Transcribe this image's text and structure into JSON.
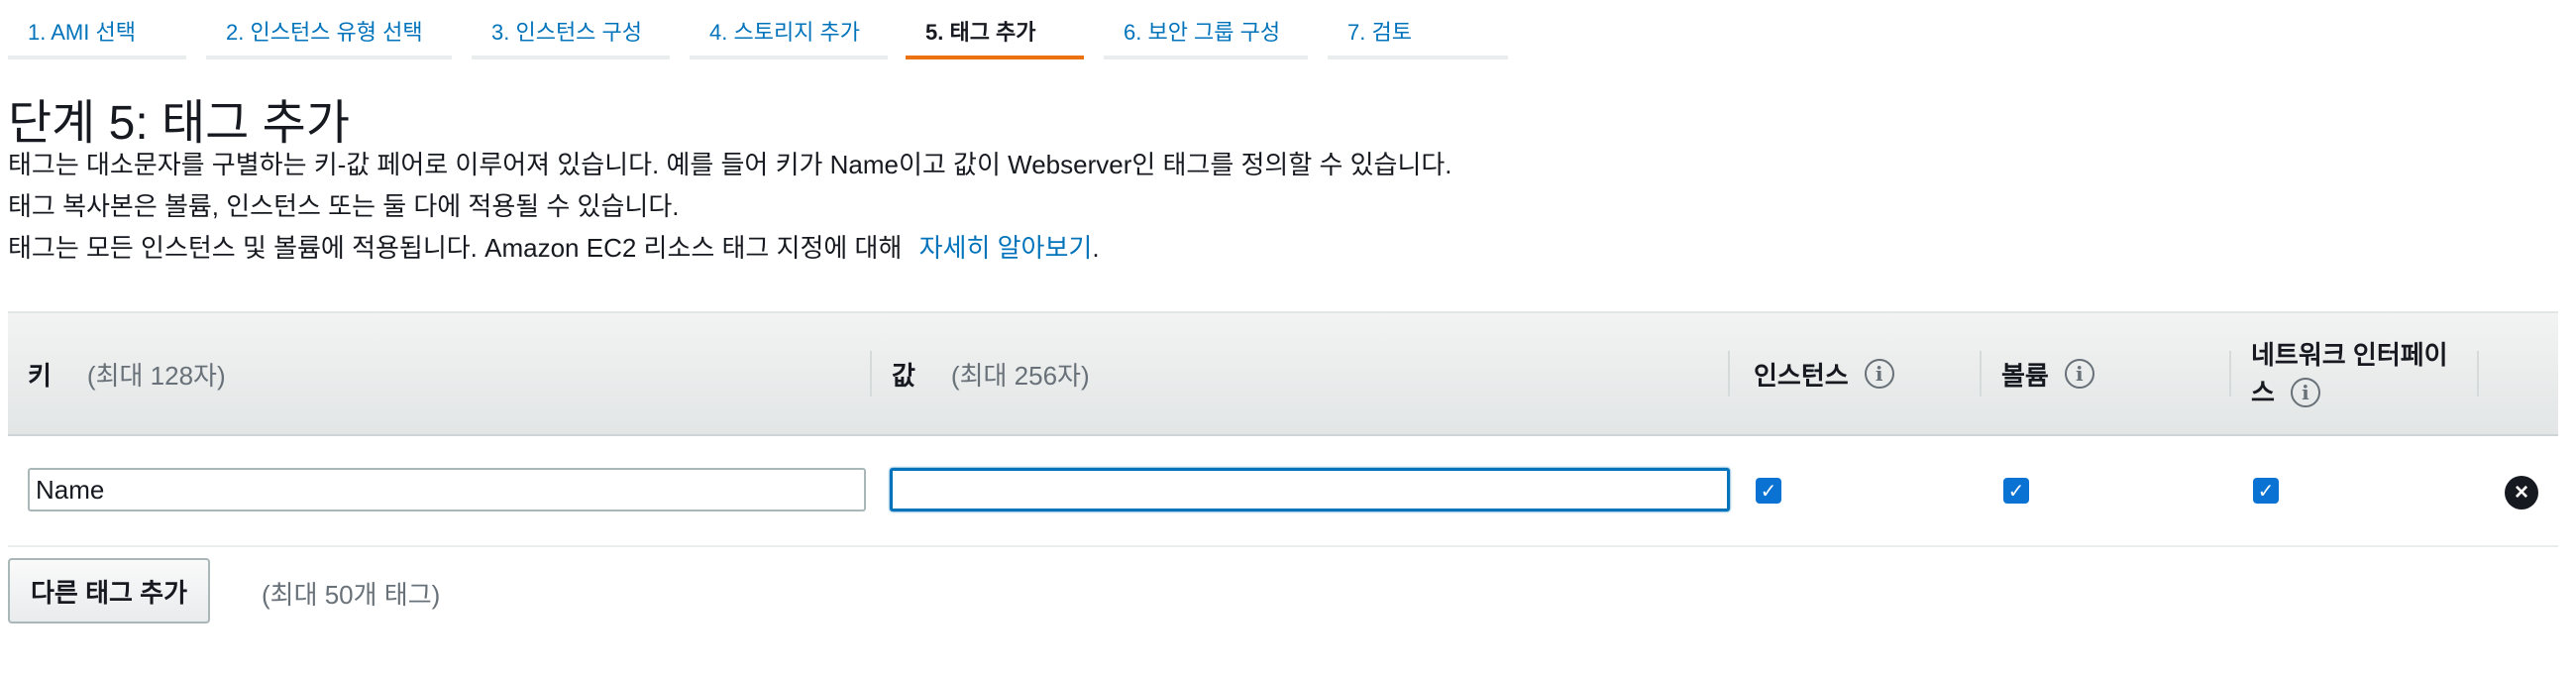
{
  "wizard": {
    "steps": [
      {
        "label": "1. AMI 선택"
      },
      {
        "label": "2. 인스턴스 유형 선택"
      },
      {
        "label": "3. 인스턴스 구성"
      },
      {
        "label": "4. 스토리지 추가"
      },
      {
        "label": "5. 태그 추가"
      },
      {
        "label": "6. 보안 그룹 구성"
      },
      {
        "label": "7. 검토"
      }
    ],
    "active_step": 5
  },
  "page": {
    "title": "단계 5: 태그 추가",
    "desc1": "태그는 대소문자를 구별하는 키-값 페어로 이루어져 있습니다. 예를 들어 키가 Name이고 값이 Webserver인 태그를 정의할 수 있습니다.",
    "desc2": "태그 복사본은 볼륨, 인스턴스 또는 둘 다에 적용될 수 있습니다.",
    "desc3_text": "태그는 모든 인스턴스 및 볼륨에 적용됩니다. Amazon EC2 리소스 태그 지정에 대해",
    "desc3_link": "자세히 알아보기",
    "desc3_end": "."
  },
  "table": {
    "headers": {
      "key": "키",
      "key_hint": "(최대 128자)",
      "value": "값",
      "value_hint": "(최대 256자)",
      "instances": "인스턴스",
      "volumes": "볼륨",
      "network_line1": "네트워크 인터페이",
      "network_line2": "스",
      "info_glyph": "i"
    },
    "rows": [
      {
        "key": "Name",
        "value": "",
        "instances": true,
        "volumes": true,
        "network_interfaces": true
      }
    ],
    "check_glyph": "✓",
    "remove_glyph": "×"
  },
  "actions": {
    "add_tag": "다른 태그 추가",
    "add_tag_hint": "(최대 50개 태그)"
  },
  "colors": {
    "link": "#0073bb",
    "active_tab_underline": "#ec7211",
    "checkbox": "#0972d3"
  }
}
